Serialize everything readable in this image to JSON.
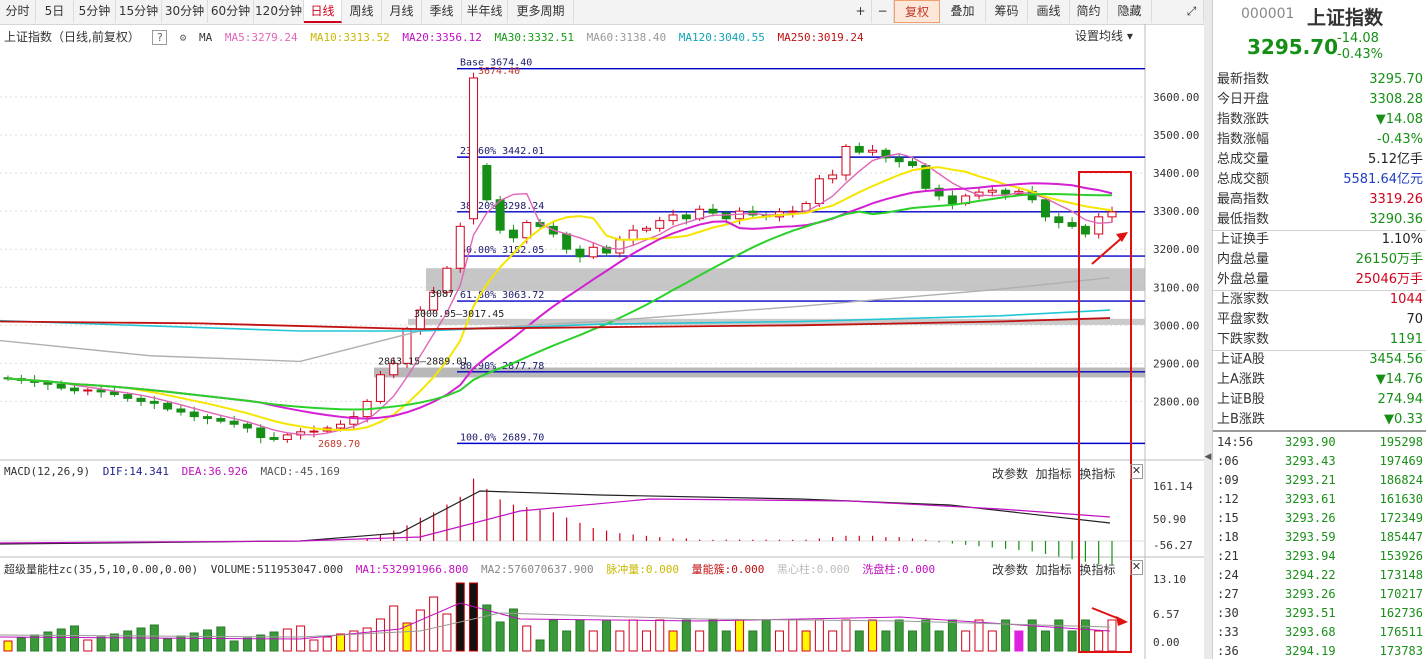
{
  "toolbar": {
    "tabs": [
      "分时",
      "5日",
      "5分钟",
      "15分钟",
      "30分钟",
      "60分钟",
      "120分钟",
      "日线",
      "周线",
      "月线",
      "季线",
      "半年线",
      "更多周期"
    ],
    "active_tab": "日线",
    "right_buttons": [
      "+",
      "−",
      "复权",
      "叠加",
      "筹码",
      "画线",
      "简约",
      "隐藏"
    ]
  },
  "chart_header": {
    "title": "上证指数（日线,前复权）",
    "ma_label": "MA",
    "ma5": "MA5:3279.24",
    "ma10": "MA10:3313.52",
    "ma20": "MA20:3356.12",
    "ma30": "MA30:3332.51",
    "ma60": "MA60:3138.40",
    "ma120": "MA120:3040.55",
    "ma250": "MA250:3019.24",
    "settings": "设置均线"
  },
  "price_axis": [
    "3600.00",
    "3500.00",
    "3400.00",
    "3300.00",
    "3200.00",
    "3100.00",
    "3000.00",
    "2900.00",
    "2800.00"
  ],
  "fib_levels": [
    {
      "label": "Base  3674.40",
      "value": 3674.4
    },
    {
      "label": "23.60% 3442.01",
      "value": 3442.01
    },
    {
      "label": "38.20% 3298.24",
      "value": 3298.24
    },
    {
      "label": "50.00% 3182.05",
      "value": 3182.05
    },
    {
      "label": "61.80% 3063.72",
      "value": 3063.72
    },
    {
      "label": "80.90% 2877.78",
      "value": 2877.78
    },
    {
      "label": "100.0% 2689.70",
      "value": 2689.7
    }
  ],
  "annotations": {
    "high": "3674.40",
    "low": "2689.70",
    "gap1": "2863.15–2889.01",
    "gap2": "3000.95–3017.45",
    "gap3": "3087"
  },
  "macd_panel": {
    "title": "MACD(12,26,9)",
    "dif": "DIF:14.341",
    "dea": "DEA:36.926",
    "macd": "MACD:-45.169",
    "axis": [
      "161.14",
      "50.90",
      "-56.27"
    ],
    "buttons": [
      "改参数",
      "加指标",
      "换指标"
    ]
  },
  "volume_panel": {
    "title": "超级量能柱zc(35,5,10,0.00,0.00)",
    "volume": "VOLUME:511953047.000",
    "ma1": "MA1:532991966.800",
    "ma2": "MA2:576070637.900",
    "c1": "脉冲量:0.000",
    "c2": "量能簇:0.000",
    "c3": "黑心柱:0.000",
    "c4": "洗盘柱:0.000",
    "axis": [
      "13.10",
      "6.57",
      "0.00"
    ],
    "buttons": [
      "改参数",
      "加指标",
      "换指标"
    ]
  },
  "quote": {
    "code": "000001",
    "name": "上证指数",
    "price": "3295.70",
    "change": "-14.08",
    "change_pct": "-0.43%",
    "rows": [
      {
        "label": "最新指数",
        "value": "3295.70",
        "color": "green"
      },
      {
        "label": "今日开盘",
        "value": "3308.28",
        "color": "green"
      },
      {
        "label": "指数涨跌",
        "value": "▼14.08",
        "color": "green"
      },
      {
        "label": "指数涨幅",
        "value": "-0.43%",
        "color": "green"
      },
      {
        "label": "总成交量",
        "value": "5.12亿手",
        "color": "black"
      },
      {
        "label": "总成交额",
        "value": "5581.64亿元",
        "color": "blue"
      },
      {
        "label": "最高指数",
        "value": "3319.26",
        "color": "red"
      },
      {
        "label": "最低指数",
        "value": "3290.36",
        "color": "green"
      },
      {
        "label": "上证换手",
        "value": "1.10%",
        "color": "black"
      },
      {
        "label": "内盘总量",
        "value": "26150万手",
        "color": "green"
      },
      {
        "label": "外盘总量",
        "value": "25046万手",
        "color": "red"
      },
      {
        "label": "上涨家数",
        "value": "1044",
        "color": "red"
      },
      {
        "label": "平盘家数",
        "value": "70",
        "color": "black"
      },
      {
        "label": "下跌家数",
        "value": "1191",
        "color": "green"
      },
      {
        "label": "上证A股",
        "value": "3454.56",
        "color": "green"
      },
      {
        "label": "上A涨跌",
        "value": "▼14.76",
        "color": "green"
      },
      {
        "label": "上证B股",
        "value": "274.94",
        "color": "green"
      },
      {
        "label": "上B涨跌",
        "value": "▼0.33",
        "color": "green"
      }
    ]
  },
  "ticks": [
    {
      "time": "14:56",
      "price": "3293.90",
      "vol": "195298",
      "vcolor": "green"
    },
    {
      "time": ":06",
      "price": "3293.43",
      "vol": "197469",
      "vcolor": "green"
    },
    {
      "time": ":09",
      "price": "3293.21",
      "vol": "186824",
      "vcolor": "green"
    },
    {
      "time": ":12",
      "price": "3293.61",
      "vol": "161630",
      "vcolor": "red"
    },
    {
      "time": ":15",
      "price": "3293.26",
      "vol": "172349",
      "vcolor": "green"
    },
    {
      "time": ":18",
      "price": "3293.59",
      "vol": "185447",
      "vcolor": "red"
    },
    {
      "time": ":21",
      "price": "3293.94",
      "vol": "153926",
      "vcolor": "red"
    },
    {
      "time": ":24",
      "price": "3294.22",
      "vol": "173148",
      "vcolor": "red"
    },
    {
      "time": ":27",
      "price": "3293.26",
      "vol": "170217",
      "vcolor": "green"
    },
    {
      "time": ":30",
      "price": "3293.51",
      "vol": "162736",
      "vcolor": "red"
    },
    {
      "time": ":33",
      "price": "3293.68",
      "vol": "176511",
      "vcolor": "red"
    },
    {
      "time": ":36",
      "price": "3294.19",
      "vol": "173783",
      "vcolor": "red"
    }
  ],
  "colors": {
    "up": "#d0021b",
    "down": "#168f16",
    "ma5": "#e066b8",
    "ma10": "#f5e600",
    "ma20": "#d41fd4",
    "ma30": "#2bd12b",
    "ma60": "#b0b0b0",
    "ma120": "#22c6d6",
    "ma250": "#c01010",
    "fib": "#0000c8"
  }
}
